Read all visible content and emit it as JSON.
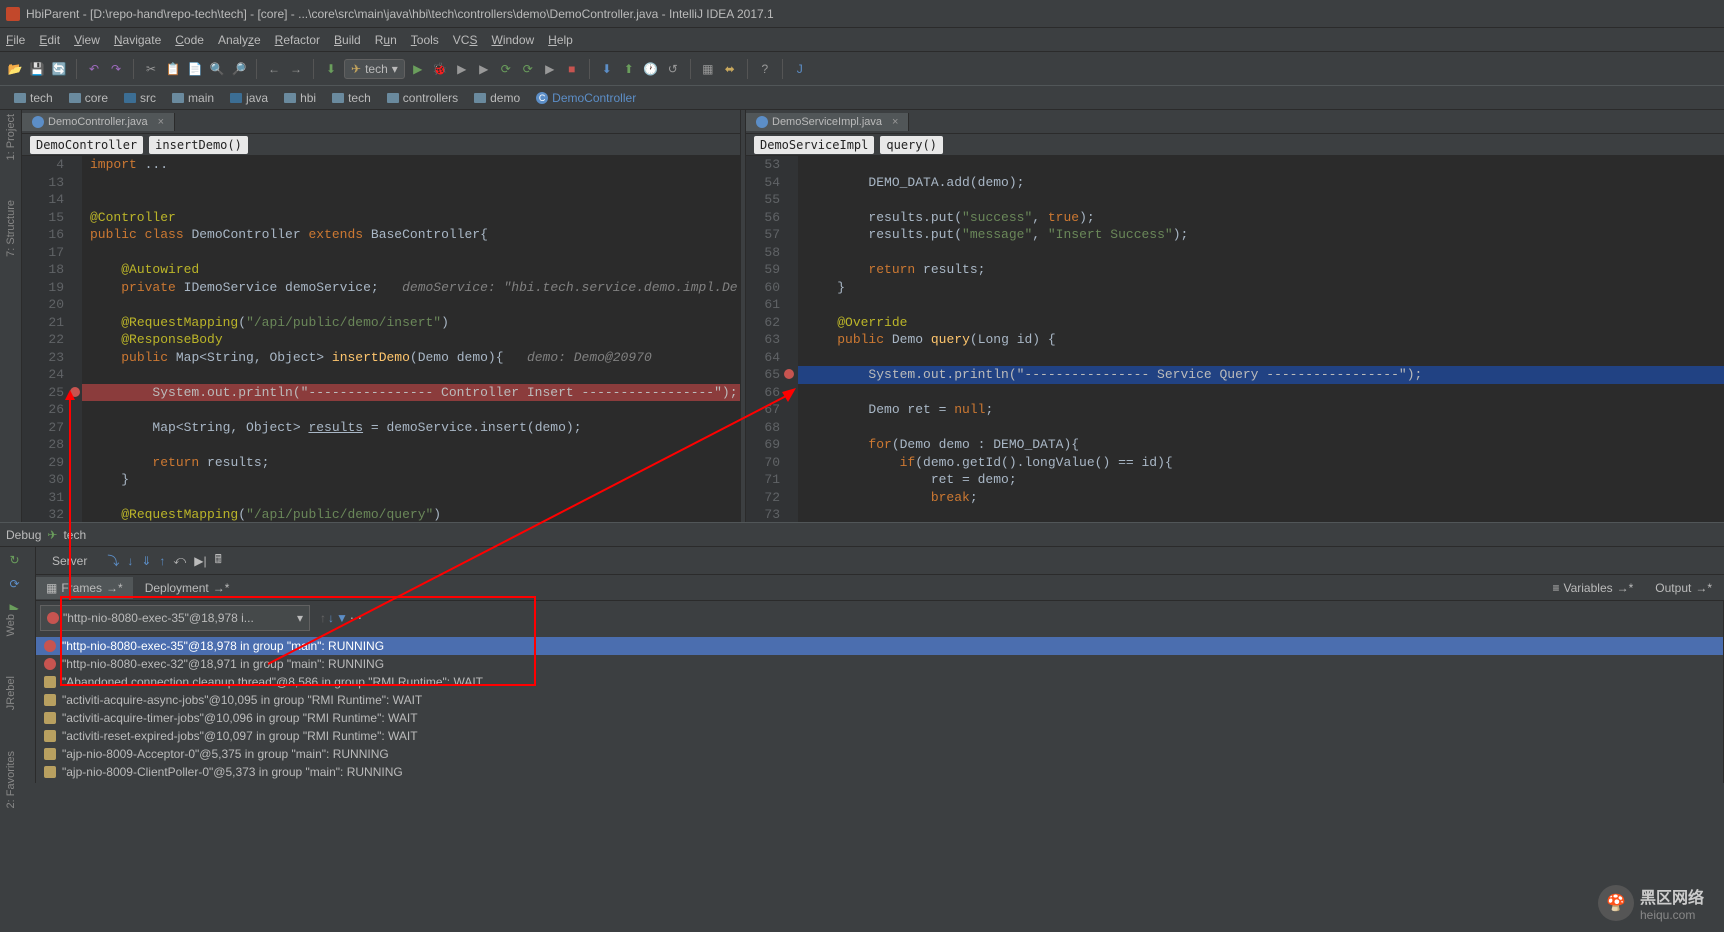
{
  "window": {
    "title": "HbiParent - [D:\\repo-hand\\repo-tech\\tech] - [core] - ...\\core\\src\\main\\java\\hbi\\tech\\controllers\\demo\\DemoController.java - IntelliJ IDEA 2017.1"
  },
  "menu": {
    "file": "File",
    "edit": "Edit",
    "view": "View",
    "navigate": "Navigate",
    "code": "Code",
    "analyze": "Analyze",
    "refactor": "Refactor",
    "build": "Build",
    "run": "Run",
    "tools": "Tools",
    "vcs": "VCS",
    "window": "Window",
    "help": "Help"
  },
  "run_config": "tech",
  "breadcrumbs": [
    "tech",
    "core",
    "src",
    "main",
    "java",
    "hbi",
    "tech",
    "controllers",
    "demo",
    "DemoController"
  ],
  "left_editor": {
    "tab": "DemoController.java",
    "crumb1": "DemoController",
    "crumb2": "insertDemo()",
    "lines": [
      {
        "n": "4",
        "html": "<span class='kw'>import</span> <span class='normal'>...</span>"
      },
      {
        "n": "13",
        "html": ""
      },
      {
        "n": "14",
        "html": ""
      },
      {
        "n": "15",
        "html": "<span class='ann'>@Controller</span>"
      },
      {
        "n": "16",
        "html": "<span class='kw'>public class</span> <span class='normal'>DemoController</span> <span class='kw'>extends</span> <span class='normal'>BaseController{</span>"
      },
      {
        "n": "17",
        "html": ""
      },
      {
        "n": "18",
        "html": "    <span class='ann'>@Autowired</span>"
      },
      {
        "n": "19",
        "html": "    <span class='kw'>private</span> <span class='normal'>IDemoService demoService;</span>   <span class='comment'>demoService: \"hbi.tech.service.demo.impl.De</span>"
      },
      {
        "n": "20",
        "html": ""
      },
      {
        "n": "21",
        "html": "    <span class='ann'>@RequestMapping</span><span class='normal'>(</span><span class='str'>\"/api/public/demo/insert\"</span><span class='normal'>)</span>"
      },
      {
        "n": "22",
        "html": "    <span class='ann'>@ResponseBody</span>"
      },
      {
        "n": "23",
        "html": "    <span class='kw'>public</span> <span class='normal'>Map&lt;String, Object&gt;</span> <span class='method'>insertDemo</span><span class='normal'>(Demo demo){</span>   <span class='comment'>demo: Demo@20970</span>"
      },
      {
        "n": "24",
        "html": ""
      },
      {
        "n": "25",
        "html": "        System.out.println(\"---------------- Controller Insert -----------------\");",
        "hl": "red"
      },
      {
        "n": "26",
        "html": ""
      },
      {
        "n": "27",
        "html": "        <span class='normal'>Map&lt;String, Object&gt; <u>results</u> = demoService.insert(demo);</span>"
      },
      {
        "n": "28",
        "html": ""
      },
      {
        "n": "29",
        "html": "        <span class='kw'>return</span> <span class='normal'>results;</span>"
      },
      {
        "n": "30",
        "html": "    <span class='normal'>}</span>"
      },
      {
        "n": "31",
        "html": ""
      },
      {
        "n": "32",
        "html": "    <span class='ann'>@RequestMapping</span><span class='normal'>(</span><span class='str'>\"/api/public/demo/query\"</span><span class='normal'>)</span>"
      }
    ]
  },
  "right_editor": {
    "tab": "DemoServiceImpl.java",
    "crumb1": "DemoServiceImpl",
    "crumb2": "query()",
    "lines": [
      {
        "n": "53",
        "html": ""
      },
      {
        "n": "54",
        "html": "        <span class='normal'>DEMO_DATA.add(demo);</span>"
      },
      {
        "n": "55",
        "html": ""
      },
      {
        "n": "56",
        "html": "        <span class='normal'>results.put(</span><span class='str'>\"success\"</span><span class='normal'>, </span><span class='kw'>true</span><span class='normal'>);</span>"
      },
      {
        "n": "57",
        "html": "        <span class='normal'>results.put(</span><span class='str'>\"message\"</span><span class='normal'>, </span><span class='str'>\"Insert Success\"</span><span class='normal'>);</span>"
      },
      {
        "n": "58",
        "html": ""
      },
      {
        "n": "59",
        "html": "        <span class='kw'>return</span> <span class='normal'>results;</span>"
      },
      {
        "n": "60",
        "html": "    <span class='normal'>}</span>"
      },
      {
        "n": "61",
        "html": ""
      },
      {
        "n": "62",
        "html": "    <span class='ann'>@Override</span>"
      },
      {
        "n": "63",
        "html": "    <span class='kw'>public</span> <span class='normal'>Demo</span> <span class='method'>query</span><span class='normal'>(Long id) {</span>"
      },
      {
        "n": "64",
        "html": ""
      },
      {
        "n": "65",
        "html": "        System.out.println(\"---------------- Service Query -----------------\");",
        "hl": "blue"
      },
      {
        "n": "66",
        "html": ""
      },
      {
        "n": "67",
        "html": "        <span class='normal'>Demo ret = </span><span class='kw'>null</span><span class='normal'>;</span>"
      },
      {
        "n": "68",
        "html": ""
      },
      {
        "n": "69",
        "html": "        <span class='kw'>for</span><span class='normal'>(Demo demo : DEMO_DATA){</span>"
      },
      {
        "n": "70",
        "html": "            <span class='kw'>if</span><span class='normal'>(demo.getId().longValue() == id){</span>"
      },
      {
        "n": "71",
        "html": "                <span class='normal'>ret = demo;</span>"
      },
      {
        "n": "72",
        "html": "                <span class='kw'>break</span><span class='normal'>;</span>"
      },
      {
        "n": "73",
        "html": ""
      }
    ]
  },
  "left_sidebar": {
    "project": "1: Project",
    "structure": "7: Structure"
  },
  "debug": {
    "title": "Debug",
    "config": "tech",
    "server_tab": "Server",
    "frames_tab": "Frames",
    "deployment_tab": "Deployment",
    "variables_tab": "Variables",
    "output_tab": "Output",
    "thread_dropdown": "\"http-nio-8080-exec-35\"@18,978 i...",
    "threads": [
      {
        "text": "\"http-nio-8080-exec-35\"@18,978 in group \"main\": RUNNING",
        "selected": true,
        "bp": true
      },
      {
        "text": "\"http-nio-8080-exec-32\"@18,971 in group \"main\": RUNNING",
        "bp": true
      },
      {
        "text": "\"Abandoned connection cleanup thread\"@8,586 in group \"RMI Runtime\": WAIT"
      },
      {
        "text": "\"activiti-acquire-async-jobs\"@10,095 in group \"RMI Runtime\": WAIT"
      },
      {
        "text": "\"activiti-acquire-timer-jobs\"@10,096 in group \"RMI Runtime\": WAIT"
      },
      {
        "text": "\"activiti-reset-expired-jobs\"@10,097 in group \"RMI Runtime\": WAIT"
      },
      {
        "text": "\"ajp-nio-8009-Acceptor-0\"@5,375 in group \"main\": RUNNING"
      },
      {
        "text": "\"ajp-nio-8009-ClientPoller-0\"@5,373 in group \"main\": RUNNING"
      }
    ]
  },
  "left_bottom": {
    "web": "Web",
    "jrebel": "JRebel",
    "favorites": "2: Favorites"
  },
  "watermark": {
    "brand": "黑区网络",
    "url": "heiqu.com"
  }
}
